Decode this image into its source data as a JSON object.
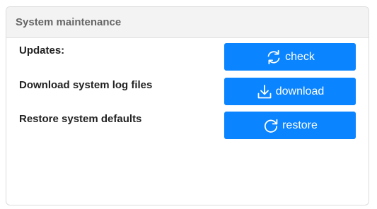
{
  "panel": {
    "title": "System maintenance"
  },
  "rows": [
    {
      "label": "Updates:",
      "button_label": "check",
      "icon": "refresh-icon"
    },
    {
      "label": "Download system log files",
      "button_label": "download",
      "icon": "download-icon"
    },
    {
      "label": "Restore system defaults",
      "button_label": "restore",
      "icon": "restore-icon"
    }
  ],
  "colors": {
    "button": "#0a84ff",
    "header_bg": "#f3f3f3"
  }
}
